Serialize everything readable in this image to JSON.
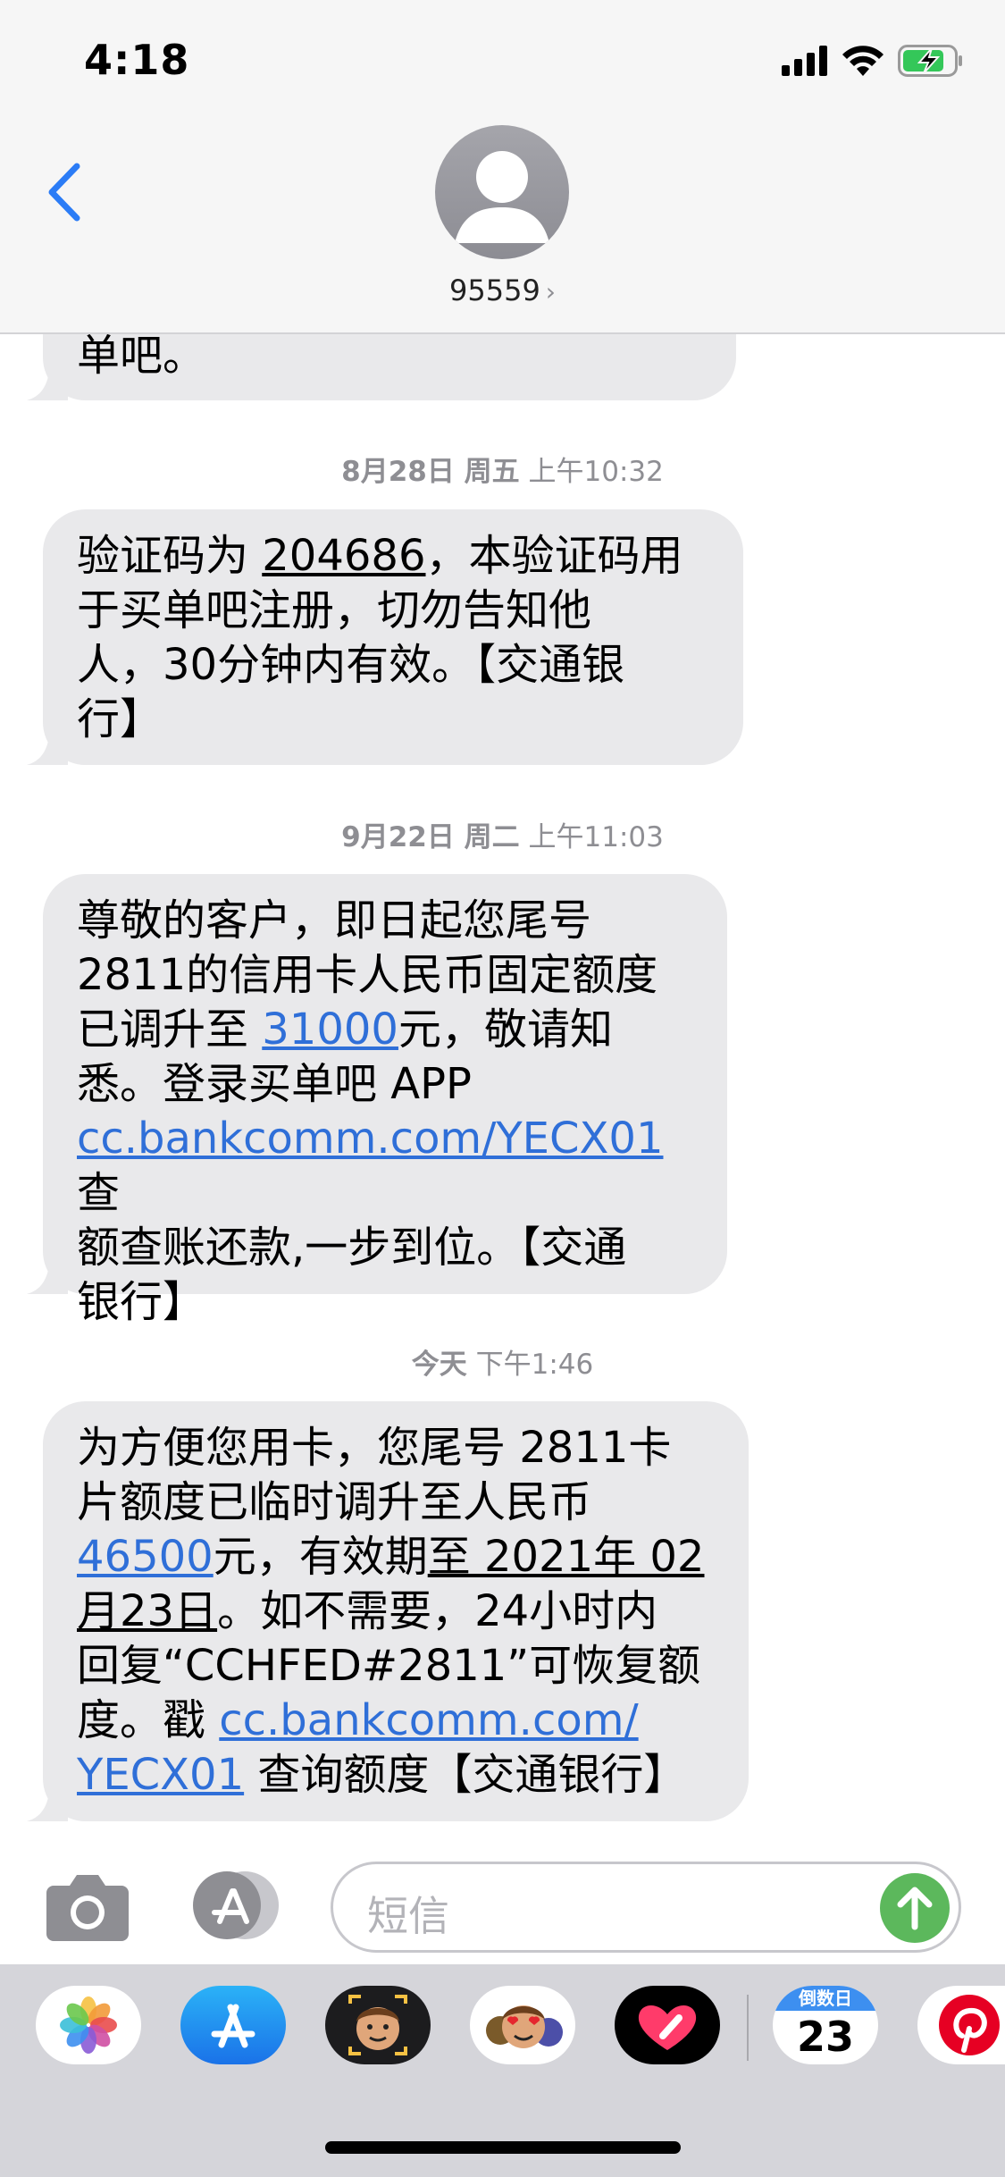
{
  "status_bar": {
    "time": "4:18"
  },
  "header": {
    "contact_name": "95559",
    "chevron": "›"
  },
  "messages": [
    {
      "type": "partial",
      "line": "单吧。"
    },
    {
      "timestamp": {
        "date": "8月28日 周五",
        "time": "上午10:32"
      }
    },
    {
      "lines": [
        {
          "parts": [
            "验证码为 ",
            "204686",
            "，本验证码用"
          ]
        },
        {
          "text": "于买单吧注册，切勿告知他"
        },
        {
          "text": "人，30分钟内有效。【交通银"
        },
        {
          "text": "行】"
        }
      ]
    },
    {
      "timestamp": {
        "date": "9月22日 周二",
        "time": "上午11:03"
      }
    },
    {
      "lines": [
        {
          "text": "尊敬的客户，即日起您尾号"
        },
        {
          "text": "2811的信用卡人民币固定额度"
        },
        {
          "parts": [
            "已调升至 ",
            "31000",
            "元，敬请知"
          ]
        },
        {
          "text": "悉。登录买单吧 APP"
        },
        {
          "parts": [
            "cc.bankcomm.com/YECX01",
            " 查"
          ]
        },
        {
          "text": "额查账还款,一步到位。【交通"
        },
        {
          "text": "银行】"
        }
      ]
    },
    {
      "timestamp": {
        "date": "今天",
        "time": "下午1:46"
      }
    },
    {
      "lines": [
        {
          "text": "为方便您用卡，您尾号 2811卡"
        },
        {
          "text": "片额度已临时调升至人民币"
        },
        {
          "parts": [
            "46500",
            "元，有效期",
            "至 2021年 02"
          ]
        },
        {
          "parts": [
            "月23日",
            "。如不需要，24小时内"
          ]
        },
        {
          "text": "回复“CCHFED#2811”可恢复额"
        },
        {
          "parts": [
            "度。戳 ",
            "cc.bankcomm.com/"
          ]
        },
        {
          "parts": [
            "YECX01",
            " 查询额度【交通银行】"
          ]
        }
      ]
    }
  ],
  "input": {
    "placeholder": "短信"
  },
  "drawer": {
    "apps": [
      {
        "name": "photos-app-icon"
      },
      {
        "name": "app-store-icon"
      },
      {
        "name": "memoji-icon"
      },
      {
        "name": "animoji-stickers-icon"
      },
      {
        "name": "digital-touch-icon"
      },
      {
        "name": "countdown-app-icon",
        "label": "倒数日",
        "number": "23"
      },
      {
        "name": "pinterest-app-icon"
      }
    ]
  },
  "colors": {
    "link": "#2f6fd8",
    "bubble": "#e9e9eb",
    "accent": "#2b7cf6",
    "send": "#5cb85c",
    "battery": "#34c759"
  }
}
